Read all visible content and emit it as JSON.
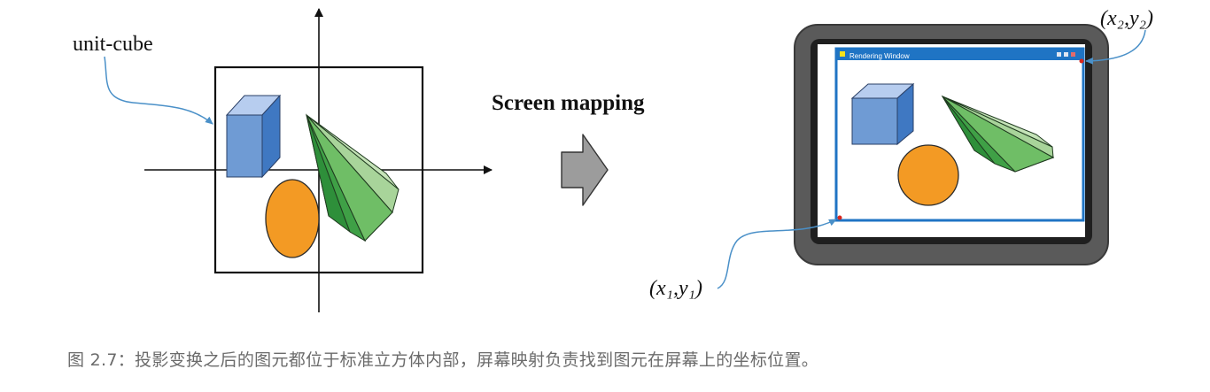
{
  "labels": {
    "unit_cube": "unit-cube",
    "screen_mapping": "Screen mapping",
    "window_title": "Rendering Window",
    "corner_bl": "(x₁,y₁)",
    "corner_tr": "(x₂,y₂)"
  },
  "caption": "图 2.7：投影变换之后的图元都位于标准立方体内部，屏幕映射负责找到图元在屏幕上的坐标位置。",
  "colors": {
    "cube_front": "#6f9bd4",
    "cube_top": "#b7cdef",
    "cube_side": "#3f78c2",
    "ellipse": "#f39a24",
    "cone_dark": "#2e8f3a",
    "cone_mid": "#58b456",
    "cone_light": "#a8d49a",
    "window_bar": "#1f74c4",
    "monitor": "#555555",
    "arrow": "#999999",
    "callout": "#4a90c8"
  }
}
